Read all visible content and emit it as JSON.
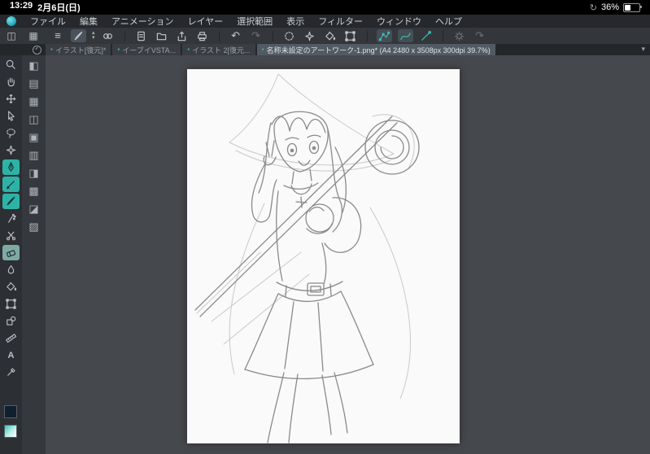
{
  "accent_color": "#2fbdb0",
  "status_bar": {
    "time": "13:29",
    "date": "2月6日(日)",
    "sync_glyph": "↻",
    "battery_percent": "36%"
  },
  "menu_bar": {
    "items": [
      "ファイル",
      "編集",
      "アニメーション",
      "レイヤー",
      "選択範囲",
      "表示",
      "フィルター",
      "ウィンドウ",
      "ヘルプ"
    ]
  },
  "toolbar": {
    "glyphs": {
      "menu": "≡",
      "chevron_up": "▴",
      "chevron_down": "▾",
      "undo": "↶",
      "redo": "↷"
    }
  },
  "tab_strip": {
    "dot_glyph": "●",
    "collapse_glyph": "▾",
    "tabs": [
      {
        "label": "イラスト[復元]*"
      },
      {
        "label": "イーブイVSTA..."
      },
      {
        "label": "イラスト 2[復元..."
      },
      {
        "label": "名称未設定のアートワーク-1.png* (A4 2480 x 3508px 300dpi 39.7%)"
      }
    ]
  },
  "left_toolbar": {
    "text_tool_glyph": "A"
  },
  "panel_column": {
    "glyphs": [
      "◧",
      "▤",
      "▦",
      "◫",
      "▣",
      "▥",
      "◨",
      "▩",
      "◪",
      "▨"
    ]
  }
}
